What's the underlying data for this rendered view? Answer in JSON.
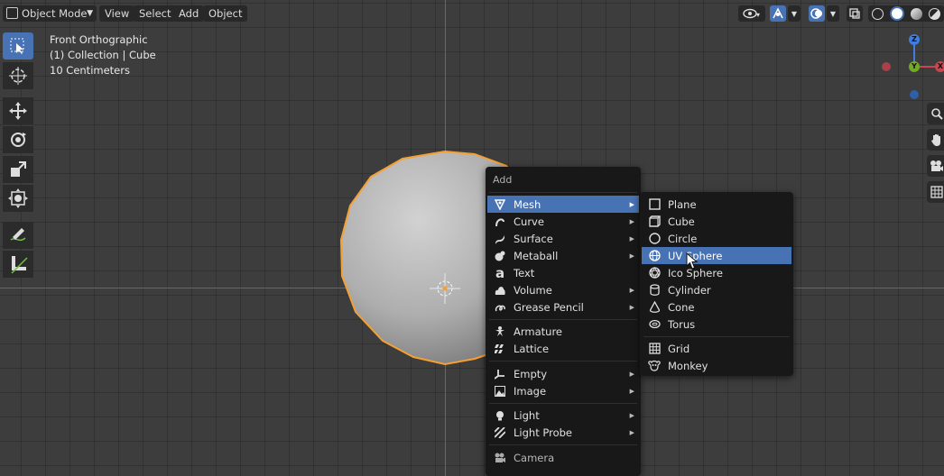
{
  "header": {
    "mode_label": "Object Mode",
    "menus": [
      "View",
      "Select",
      "Add",
      "Object"
    ]
  },
  "overlay": {
    "view_name": "Front Orthographic",
    "collection": "(1) Collection | Cube",
    "scale": "10 Centimeters"
  },
  "gizmo": {
    "z": "Z",
    "y": "Y",
    "x": "X"
  },
  "add_menu": {
    "title": "Add",
    "items": [
      {
        "label": "Mesh",
        "icon": "mesh-icon",
        "submenu": true,
        "highlighted": true
      },
      {
        "label": "Curve",
        "icon": "curve-icon",
        "submenu": true
      },
      {
        "label": "Surface",
        "icon": "surface-icon",
        "submenu": true
      },
      {
        "label": "Metaball",
        "icon": "metaball-icon",
        "submenu": true
      },
      {
        "label": "Text",
        "icon": "text-icon",
        "submenu": false
      },
      {
        "label": "Volume",
        "icon": "volume-icon",
        "submenu": true
      },
      {
        "label": "Grease Pencil",
        "icon": "grease-pencil-icon",
        "submenu": true
      },
      {
        "label": "Armature",
        "icon": "armature-icon",
        "submenu": false
      },
      {
        "label": "Lattice",
        "icon": "lattice-icon",
        "submenu": false
      },
      {
        "label": "Empty",
        "icon": "empty-icon",
        "submenu": true
      },
      {
        "label": "Image",
        "icon": "image-icon",
        "submenu": true
      },
      {
        "label": "Light",
        "icon": "light-icon",
        "submenu": true
      },
      {
        "label": "Light Probe",
        "icon": "light-probe-icon",
        "submenu": true
      },
      {
        "label": "Camera",
        "icon": "camera-icon",
        "submenu": false
      }
    ]
  },
  "mesh_menu": {
    "items": [
      {
        "label": "Plane",
        "icon": "plane-icon"
      },
      {
        "label": "Cube",
        "icon": "cube-icon"
      },
      {
        "label": "Circle",
        "icon": "circle-icon"
      },
      {
        "label": "UV Sphere",
        "icon": "uv-sphere-icon",
        "highlighted": true
      },
      {
        "label": "Ico Sphere",
        "icon": "ico-sphere-icon"
      },
      {
        "label": "Cylinder",
        "icon": "cylinder-icon"
      },
      {
        "label": "Cone",
        "icon": "cone-icon"
      },
      {
        "label": "Torus",
        "icon": "torus-icon"
      },
      {
        "label": "Grid",
        "icon": "grid-icon"
      },
      {
        "label": "Monkey",
        "icon": "monkey-icon"
      }
    ]
  },
  "colors": {
    "accent": "#4772b3",
    "selection_outline": "#f5a033",
    "x_axis": "#c8464f",
    "y_axis": "#74a829",
    "z_axis": "#3d7ee0"
  }
}
